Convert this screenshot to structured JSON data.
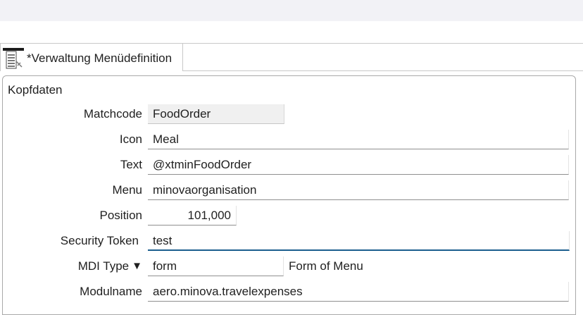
{
  "editor_tab": {
    "title": "*Verwaltung Menüdefinition",
    "icon": "menu-definition-icon"
  },
  "section": {
    "title": "Kopfdaten"
  },
  "fields": {
    "matchcode": {
      "label": "Matchcode",
      "value": "FoodOrder"
    },
    "icon": {
      "label": "Icon",
      "value": "Meal"
    },
    "text": {
      "label": "Text",
      "value": "@xtminFoodOrder"
    },
    "menu": {
      "label": "Menu",
      "value": "minovaorganisation"
    },
    "position": {
      "label": "Position",
      "value": "101,000"
    },
    "security_token": {
      "label": "Security Token",
      "value": "test"
    },
    "mdi_type": {
      "label": "MDI Type",
      "arrow": "▼",
      "value": "form",
      "description": "Form of Menu"
    },
    "modulname": {
      "label": "Modulname",
      "value": "aero.minova.travelexpenses"
    }
  },
  "colors": {
    "focus_underline": "#1b5e8e",
    "readonly_background": "#f0f0f0",
    "top_band": "#f2f2f6"
  }
}
